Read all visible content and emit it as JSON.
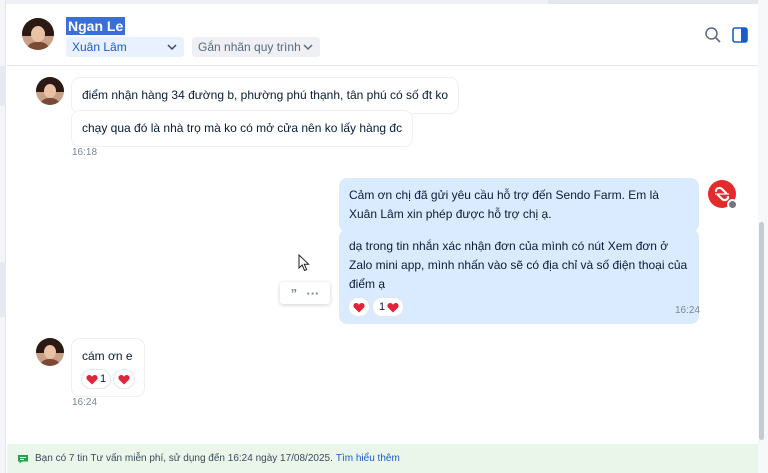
{
  "header": {
    "contact_name": "Ngan Le",
    "assignee": "Xuân Lâm",
    "tag_label": "Gắn nhãn quy trình"
  },
  "messages": {
    "incoming_1": {
      "line1": "điểm nhận hàng 34 đường b, phường phú thạnh, tân phú có số đt ko",
      "line2": "chạy qua đó là nhà trọ mà ko có mở cửa nên ko lấy hàng đc",
      "time": "16:18"
    },
    "outgoing_1": {
      "text1": "Cảm ơn chị đã gửi yêu cầu hỗ trợ đến Sendo Farm. Em là Xuân Lâm xin phép được hỗ trợ chị ạ.",
      "text2": "dạ trong tin nhắn xác nhận đơn của mình có nút Xem đơn ở Zalo mini app, mình nhấn vào sẽ có địa chỉ và số điện thoại của điểm ạ",
      "reaction_count": "1",
      "time": "16:24"
    },
    "incoming_2": {
      "text": "cám ơn e",
      "reaction_count": "1",
      "time": "16:24"
    }
  },
  "quote_actions": {
    "quote_glyph": "”",
    "more_glyph": "···"
  },
  "notice": {
    "text": "Bạn có 7 tin Tư vấn miễn phí, sử dụng đến 16:24 ngày 17/08/2025.",
    "link": "Tìm hiểu thêm"
  },
  "colors": {
    "accent": "#1a5bd0",
    "outgoing_bubble": "#dbebff",
    "heart": "#e0243a",
    "notice_bg": "#eaf6ea"
  },
  "icons": [
    "search-icon",
    "panel-toggle-icon",
    "chevron-down-icon",
    "heart-icon",
    "quote-icon",
    "more-icon",
    "message-icon",
    "cursor-icon"
  ]
}
